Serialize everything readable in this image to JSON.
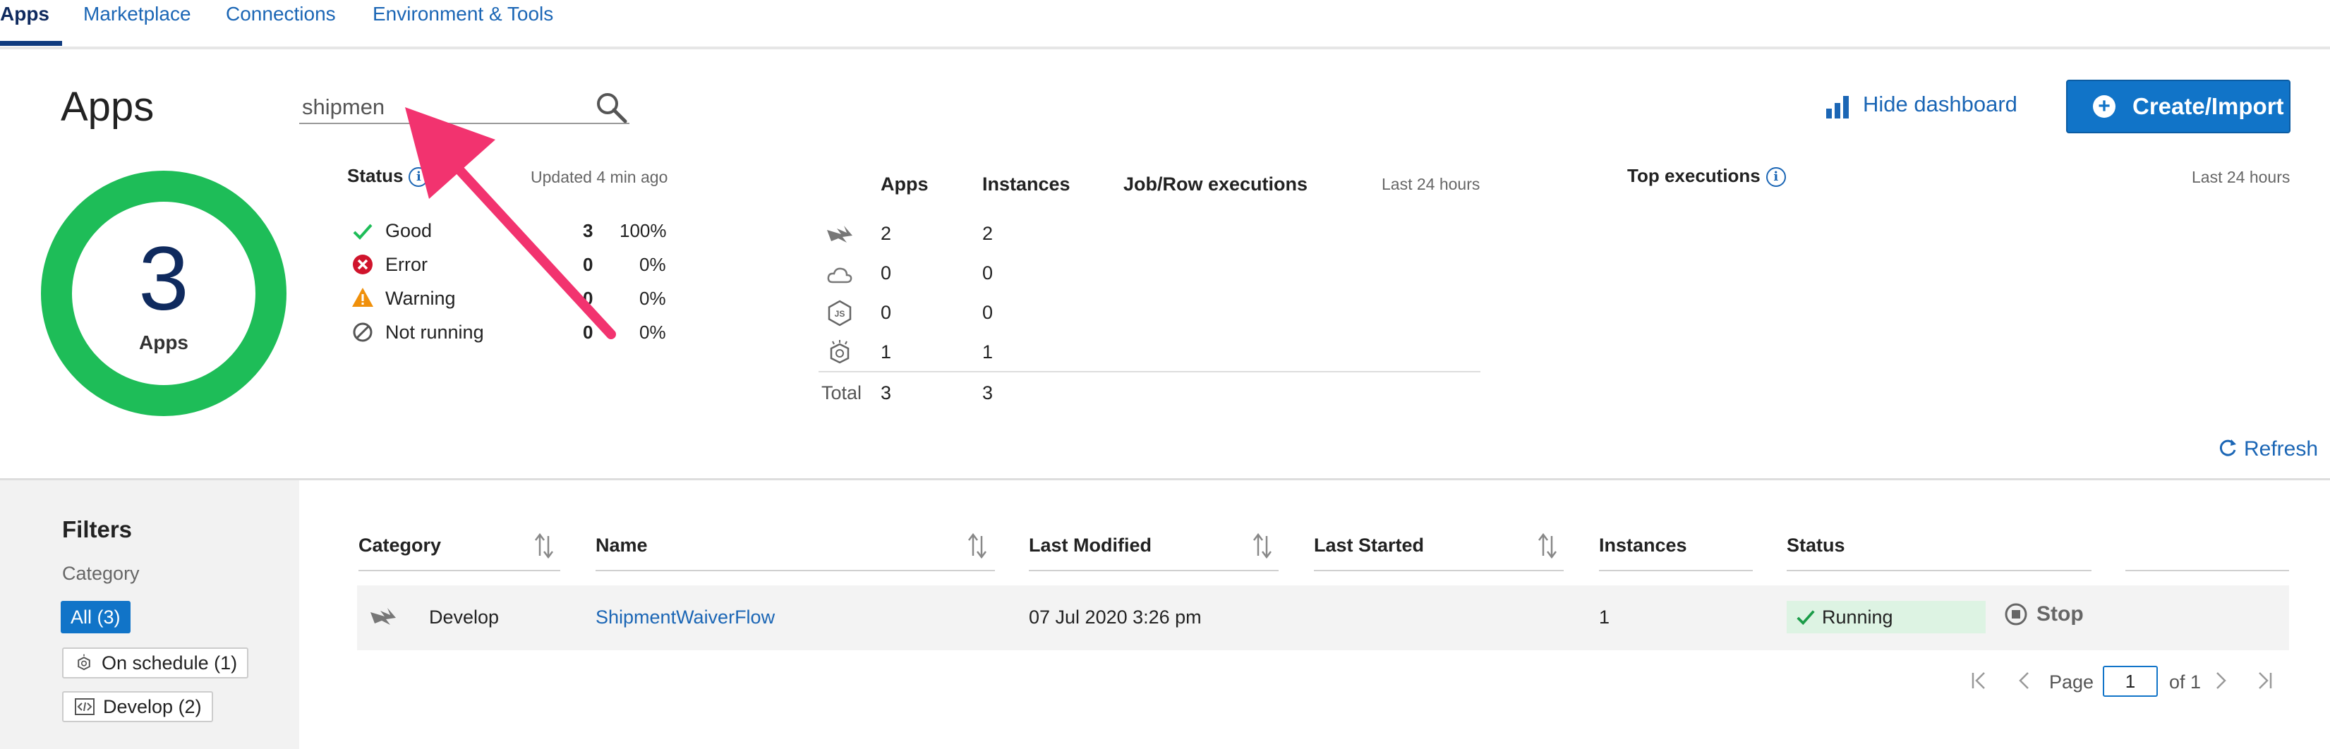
{
  "nav": {
    "tabs": [
      {
        "label": "Apps",
        "active": true
      },
      {
        "label": "Marketplace"
      },
      {
        "label": "Connections"
      },
      {
        "label": "Environment & Tools"
      }
    ]
  },
  "header": {
    "title": "Apps",
    "search": {
      "value": "shipmen"
    },
    "hide_dashboard": "Hide dashboard",
    "create_import": "Create/Import"
  },
  "ring": {
    "count": "3",
    "label": "Apps",
    "color": "#1ebd58"
  },
  "status": {
    "title": "Status",
    "updated": "Updated 4 min ago",
    "rows": [
      {
        "label": "Good",
        "count": "3",
        "pct": "100%",
        "icon": "check-icon"
      },
      {
        "label": "Error",
        "count": "0",
        "pct": "0%",
        "icon": "error-icon"
      },
      {
        "label": "Warning",
        "count": "0",
        "pct": "0%",
        "icon": "warning-icon"
      },
      {
        "label": "Not running",
        "count": "0",
        "pct": "0%",
        "icon": "not-running-icon"
      }
    ]
  },
  "counts": {
    "col_apps": "Apps",
    "col_instances": "Instances",
    "col_executions": "Job/Row executions",
    "period": "Last 24 hours",
    "rows": [
      {
        "type": "flogo-icon",
        "apps": "2",
        "instances": "2"
      },
      {
        "type": "cloud-icon",
        "apps": "0",
        "instances": "0"
      },
      {
        "type": "nodejs-icon",
        "apps": "0",
        "instances": "0"
      },
      {
        "type": "scheduled-icon",
        "apps": "1",
        "instances": "1"
      }
    ],
    "total_label": "Total",
    "total_apps": "3",
    "total_instances": "3"
  },
  "top_executions": {
    "title": "Top executions",
    "period": "Last 24 hours"
  },
  "refresh": "Refresh",
  "filters": {
    "title": "Filters",
    "category_label": "Category",
    "chips": [
      {
        "label": "All (3)",
        "selected": true
      },
      {
        "label": "On schedule (1)"
      },
      {
        "label": "Develop (2)"
      }
    ]
  },
  "table": {
    "headers": [
      "Category",
      "Name",
      "Last Modified",
      "Last Started",
      "Instances",
      "Status"
    ],
    "rows": [
      {
        "category": "Develop",
        "name": "ShipmentWaiverFlow",
        "last_modified": "07 Jul 2020 3:26 pm",
        "last_started": "",
        "instances": "1",
        "status": "Running",
        "action": "Stop"
      }
    ]
  },
  "pagination": {
    "page_label": "Page",
    "page_value": "1",
    "of_label": "of 1"
  },
  "colors": {
    "accent": "#1174c8",
    "success": "#1ebd58",
    "error": "#d0142c",
    "warning": "#f0900b",
    "annotation_arrow": "#f2336f"
  }
}
